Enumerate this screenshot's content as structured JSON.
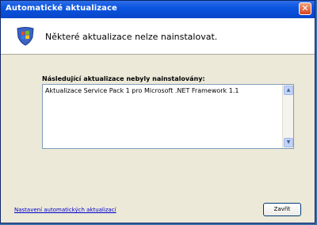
{
  "window": {
    "title": "Automatické aktualizace",
    "close_glyph": "✕"
  },
  "header": {
    "message": "Některé aktualizace nelze nainstalovat.",
    "icon": "windows-update-shield-icon"
  },
  "list": {
    "label": "Následující aktualizace nebyly nainstalovány:",
    "items": [
      "Aktualizace Service Pack 1 pro Microsoft .NET Framework 1.1"
    ]
  },
  "footer": {
    "settings_link": "Nastavení automatických aktualizací",
    "close_button": "Zavřít"
  },
  "colors": {
    "titlebar": "#0a55e0",
    "window_bg": "#ece9d8",
    "link": "#0000cc"
  }
}
